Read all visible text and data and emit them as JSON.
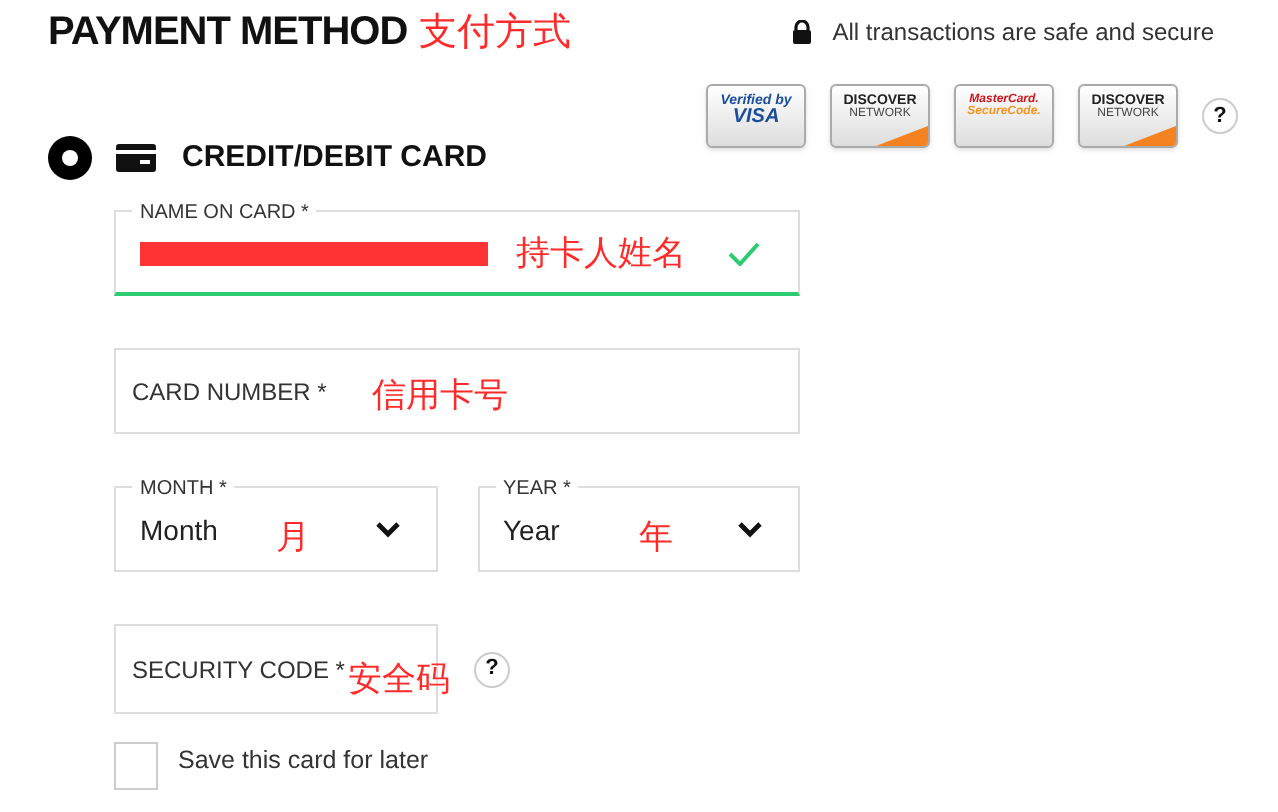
{
  "header": {
    "title": "PAYMENT METHOD",
    "title_note": "支付方式",
    "secure_text": "All transactions are safe and secure"
  },
  "card_badges": [
    {
      "kind": "visa",
      "lines": [
        "Verified by",
        "VISA"
      ]
    },
    {
      "kind": "discover",
      "lines": [
        "DISCOVER",
        "NETWORK"
      ]
    },
    {
      "kind": "mastercard",
      "lines": [
        "MasterCard.",
        "SecureCode."
      ]
    },
    {
      "kind": "discover",
      "lines": [
        "DISCOVER",
        "NETWORK"
      ]
    }
  ],
  "help_button": "?",
  "payment_option": {
    "label": "CREDIT/DEBIT CARD",
    "selected": true
  },
  "name_field": {
    "label": "NAME ON CARD *",
    "note": "持卡人姓名",
    "valid": true,
    "redacted": true
  },
  "card_number_field": {
    "placeholder": "CARD NUMBER *",
    "note": "信用卡号"
  },
  "month_select": {
    "label": "MONTH *",
    "value": "Month",
    "note": "月"
  },
  "year_select": {
    "label": "YEAR *",
    "value": "Year",
    "note": "年"
  },
  "security_field": {
    "placeholder": "SECURITY CODE *",
    "note": "安全码",
    "help": "?"
  },
  "save_card": {
    "label": "Save this card for later",
    "checked": false
  }
}
